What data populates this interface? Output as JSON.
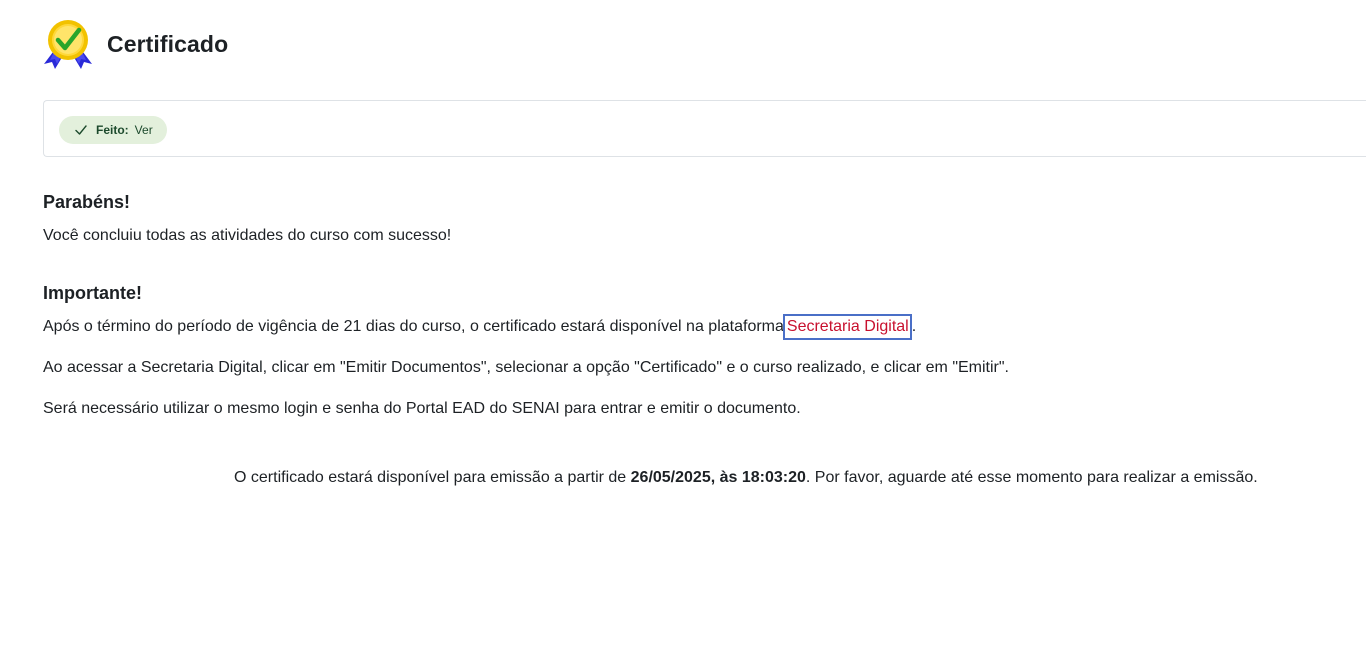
{
  "header": {
    "icon": "certificate-award-icon",
    "title": "Certificado"
  },
  "completion": {
    "icon": "check-icon",
    "status_label": "Feito:",
    "status_value": "Ver",
    "badge_color": "#e3f0dc"
  },
  "content": {
    "congrats_heading": "Parabéns!",
    "congrats_text": "Você concluiu todas as atividades do curso com sucesso!",
    "important_heading": "Importante!",
    "line1_prefix": "Após o término do período de vigência de 21 dias do curso, o certificado estará disponível na plataforma",
    "line1_link": "Secretaria Digital",
    "line1_suffix": ".",
    "line2": "Ao acessar a Secretaria Digital, clicar em \"Emitir Documentos\", selecionar a opção \"Certificado\" e o curso realizado, e clicar em \"Emitir\".",
    "line3": "Será necessário utilizar o mesmo login e senha do Portal EAD do SENAI para entrar e emitir o documento."
  },
  "availability": {
    "prefix": "O certificado estará disponível para emissão a partir de ",
    "datetime": "26/05/2025, às 18:03:20",
    "suffix": ". Por favor, aguarde até esse momento para realizar a emissão."
  },
  "colors": {
    "link": "#c8102e",
    "focus_outline": "#4a6fc7",
    "text": "#1d2125"
  }
}
